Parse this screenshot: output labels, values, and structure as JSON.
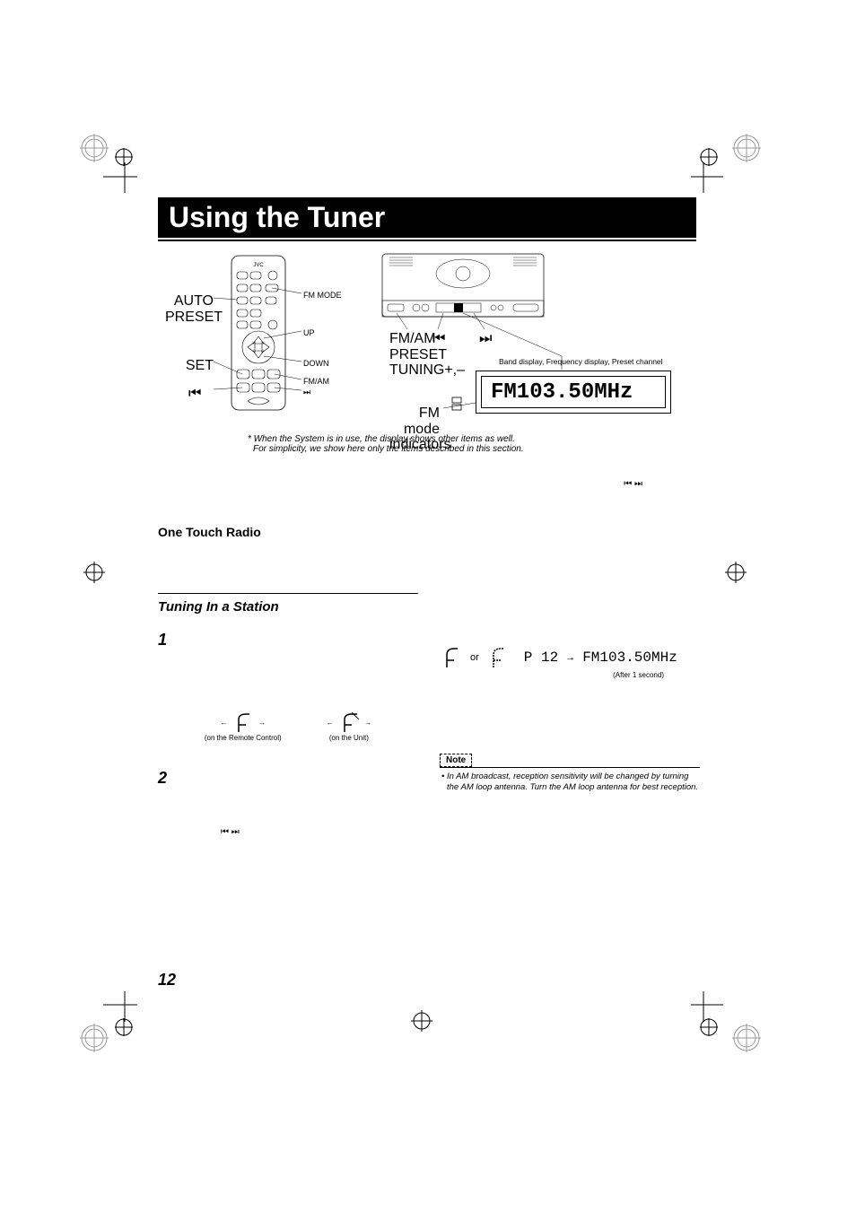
{
  "title": "Using the Tuner",
  "remote": {
    "auto_preset": "AUTO\nPRESET",
    "set": "SET",
    "fm_mode": "FM MODE",
    "up": "UP",
    "down": "DOWN",
    "fm_am": "FM/AM",
    "prev": "⏮",
    "next": "⏭"
  },
  "unit": {
    "fm_am": "FM/AM\nPRESET\nTUNING+,–",
    "prev": "⏮",
    "next": "⏭",
    "band_label": "Band display, Frequency display, Preset channel",
    "fm_indicators": "FM mode\nindicators",
    "lcd_value": "FM103.50MHz"
  },
  "footnote": {
    "line1": "* When the System is in use, the display shows other items as well.",
    "line2": "For simplicity, we show here only the items described in this section."
  },
  "hidden_arrows": "⏮    ⏭",
  "one_touch_heading": "One Touch Radio",
  "tuning_heading": "Tuning In a Station",
  "step1": "1",
  "step2": "2",
  "antenna": {
    "remote_caption": "(on the Remote Control)",
    "unit_caption": "(on the Unit)",
    "left_arrow": "←",
    "right_arrow": "→"
  },
  "skip_icons": "⏮     ⏭",
  "preset": {
    "or": "or",
    "p_label": "P 12",
    "arrow": "→",
    "freq": "FM103.50MHz",
    "after": "(After 1 second)"
  },
  "note": {
    "label": "Note",
    "bullet": "•",
    "text": "In AM broadcast, reception sensitivity will be changed by turning the AM loop antenna. Turn the AM loop antenna for best reception."
  },
  "page_number": "12"
}
